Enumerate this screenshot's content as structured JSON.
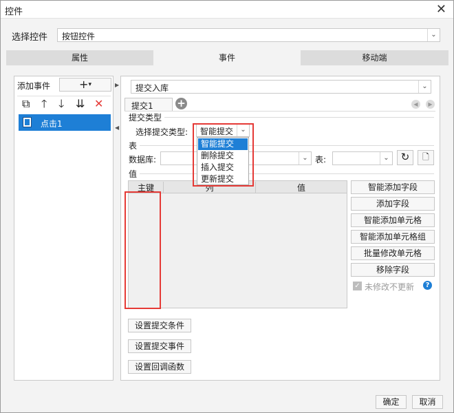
{
  "window": {
    "title": "控件",
    "close_icon": "close-icon"
  },
  "widget_select": {
    "label": "选择控件",
    "value": "按钮控件"
  },
  "tabs": [
    {
      "label": "属性",
      "active": false
    },
    {
      "label": "事件",
      "active": true
    },
    {
      "label": "移动端",
      "active": false
    }
  ],
  "left": {
    "add_event_label": "添加事件",
    "add_button": "+",
    "event_items": [
      {
        "label": "点击1"
      }
    ]
  },
  "right": {
    "action_value": "提交入库",
    "sub_tab": "提交1",
    "submit_type_section": "提交类型",
    "submit_type_label": "选择提交类型:",
    "submit_type_value": "智能提交",
    "submit_type_options": [
      "智能提交",
      "删除提交",
      "插入提交",
      "更新提交"
    ],
    "table_section": "表",
    "database_label": "数据库:",
    "table_label": "表:",
    "value_section": "值",
    "columns": [
      "主键",
      "列",
      "值"
    ],
    "side_buttons": [
      "智能添加字段",
      "添加字段",
      "智能添加单元格",
      "智能添加单元格组",
      "批量修改单元格",
      "移除字段"
    ],
    "unmodified_checkbox": {
      "label": "未修改不更新",
      "checked": true
    },
    "bottom_buttons": [
      "设置提交条件",
      "设置提交事件",
      "设置回调函数"
    ]
  },
  "footer": {
    "ok": "确定",
    "cancel": "取消"
  },
  "colors": {
    "selection": "#1e7fd6",
    "highlight": "#e53935"
  }
}
